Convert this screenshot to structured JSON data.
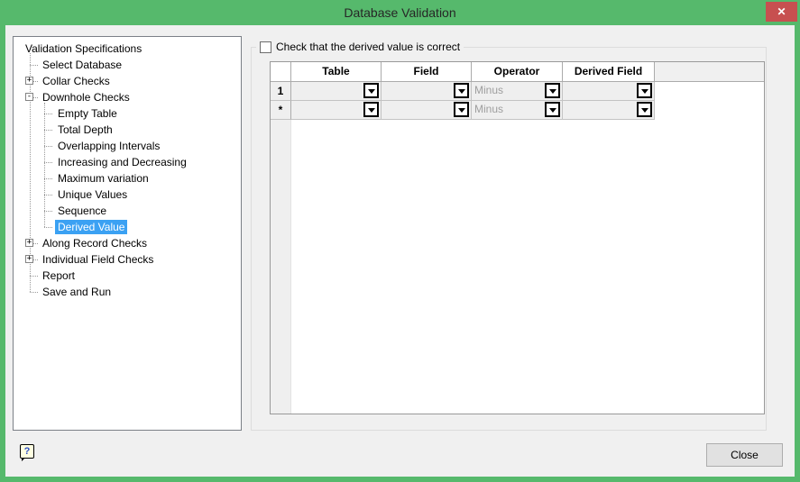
{
  "window": {
    "title": "Database Validation",
    "close_glyph": "✕"
  },
  "colors": {
    "titlebar_green": "#56b96c",
    "close_red": "#c75050",
    "selection_blue": "#3ba1f3",
    "dialog_bg": "#f0f0f0",
    "cell_gray": "#efefef",
    "disabled_text": "#9e9e9e"
  },
  "tree": {
    "items": [
      {
        "label": "Validation Specifications",
        "level": 0,
        "expander": null,
        "selected": false
      },
      {
        "label": "Select Database",
        "level": 1,
        "expander": null,
        "selected": false
      },
      {
        "label": "Collar Checks",
        "level": 1,
        "expander": "+",
        "selected": false
      },
      {
        "label": "Downhole Checks",
        "level": 1,
        "expander": "-",
        "selected": false
      },
      {
        "label": "Empty Table",
        "level": 2,
        "expander": null,
        "selected": false
      },
      {
        "label": "Total Depth",
        "level": 2,
        "expander": null,
        "selected": false
      },
      {
        "label": "Overlapping Intervals",
        "level": 2,
        "expander": null,
        "selected": false
      },
      {
        "label": "Increasing and Decreasing",
        "level": 2,
        "expander": null,
        "selected": false
      },
      {
        "label": "Maximum variation",
        "level": 2,
        "expander": null,
        "selected": false
      },
      {
        "label": "Unique Values",
        "level": 2,
        "expander": null,
        "selected": false
      },
      {
        "label": "Sequence",
        "level": 2,
        "expander": null,
        "selected": false
      },
      {
        "label": "Derived Value",
        "level": 2,
        "expander": null,
        "selected": true
      },
      {
        "label": "Along Record Checks",
        "level": 1,
        "expander": "+",
        "selected": false
      },
      {
        "label": "Individual Field Checks",
        "level": 1,
        "expander": "+",
        "selected": false
      },
      {
        "label": "Report",
        "level": 1,
        "expander": null,
        "selected": false
      },
      {
        "label": "Save and Run",
        "level": 1,
        "expander": null,
        "selected": false
      }
    ]
  },
  "panel": {
    "checkbox_label": "Check that the derived value is correct",
    "checkbox_checked": false,
    "grid": {
      "columns": [
        "Table",
        "Field",
        "Operator",
        "Derived Field"
      ],
      "column_keys": [
        "table",
        "field",
        "operator",
        "derived_field"
      ],
      "rows": [
        {
          "header": "1",
          "table": "",
          "field": "",
          "operator": "Minus",
          "derived_field": ""
        },
        {
          "header": "*",
          "table": "",
          "field": "",
          "operator": "Minus",
          "derived_field": ""
        }
      ]
    }
  },
  "footer": {
    "help_glyph": "?",
    "close_button": "Close"
  }
}
